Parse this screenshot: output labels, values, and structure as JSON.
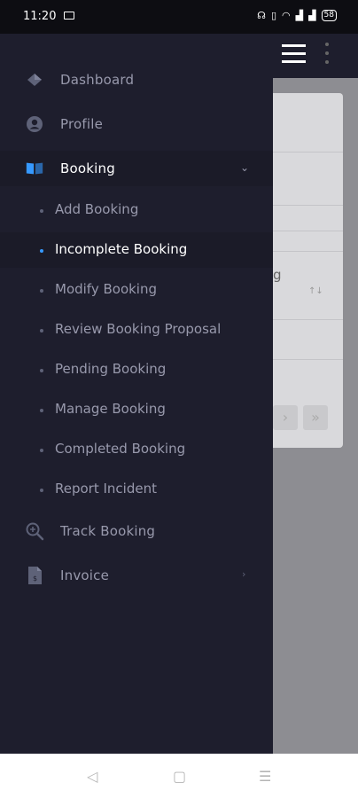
{
  "status_bar": {
    "time": "11:20",
    "battery": "58"
  },
  "drawer": {
    "items": [
      {
        "label": "Dashboard",
        "icon": "diamond-icon"
      },
      {
        "label": "Profile",
        "icon": "user-circle-icon"
      },
      {
        "label": "Booking",
        "icon": "book-open-icon",
        "expanded": true
      }
    ],
    "booking_submenu": [
      "Add Booking",
      "Incomplete Booking",
      "Modify Booking",
      "Review Booking Proposal",
      "Pending Booking",
      "Manage Booking",
      "Completed Booking",
      "Report Incident"
    ],
    "active_submenu": "Incomplete Booking",
    "bottom_items": [
      {
        "label": "Track Booking",
        "icon": "search-zoom-icon"
      },
      {
        "label": "Invoice",
        "icon": "invoice-file-icon"
      }
    ]
  },
  "background_table": {
    "header_fragment": "g",
    "sort_glyph": "↑↓",
    "pager_next": "›",
    "pager_last": "»"
  },
  "colors": {
    "drawer_bg": "#1e1e2d",
    "active_bullet": "#3699ff",
    "text_muted": "#9899ac",
    "text_active": "#ffffff"
  }
}
